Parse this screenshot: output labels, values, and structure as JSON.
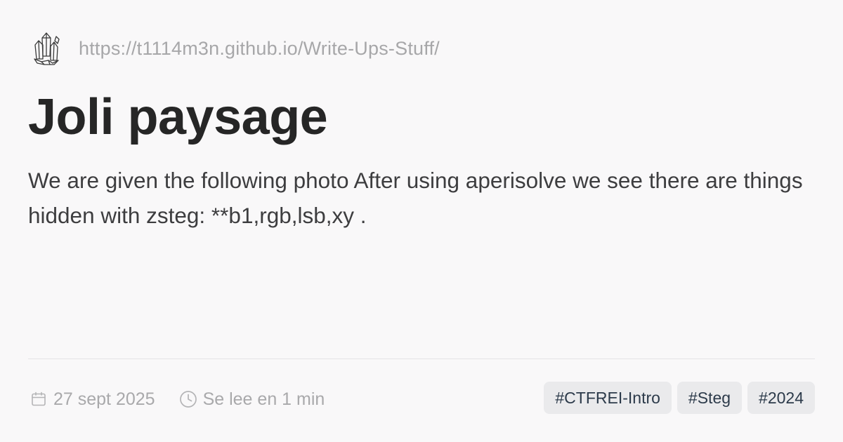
{
  "site": {
    "logo_icon": "crystal-cluster-icon",
    "url": "https://t1114m3n.github.io/Write-Ups-Stuff/"
  },
  "post": {
    "title": "Joli paysage",
    "excerpt": "We are given the following photo After using aperisolve we see there are things hidden with zsteg: **b1,rgb,lsb,xy ."
  },
  "meta": {
    "date_icon": "calendar-icon",
    "date": "27 sept 2025",
    "reading_time_icon": "clock-icon",
    "reading_time": "Se lee en 1 min"
  },
  "tags": [
    {
      "label": "#CTFREI-Intro"
    },
    {
      "label": "#Steg"
    },
    {
      "label": "#2024"
    }
  ],
  "colors": {
    "background": "#f9f8f9",
    "title": "#262626",
    "muted": "#a7a7a9",
    "tag_background": "#eaeaec",
    "tag_text": "#2c3a4a"
  }
}
